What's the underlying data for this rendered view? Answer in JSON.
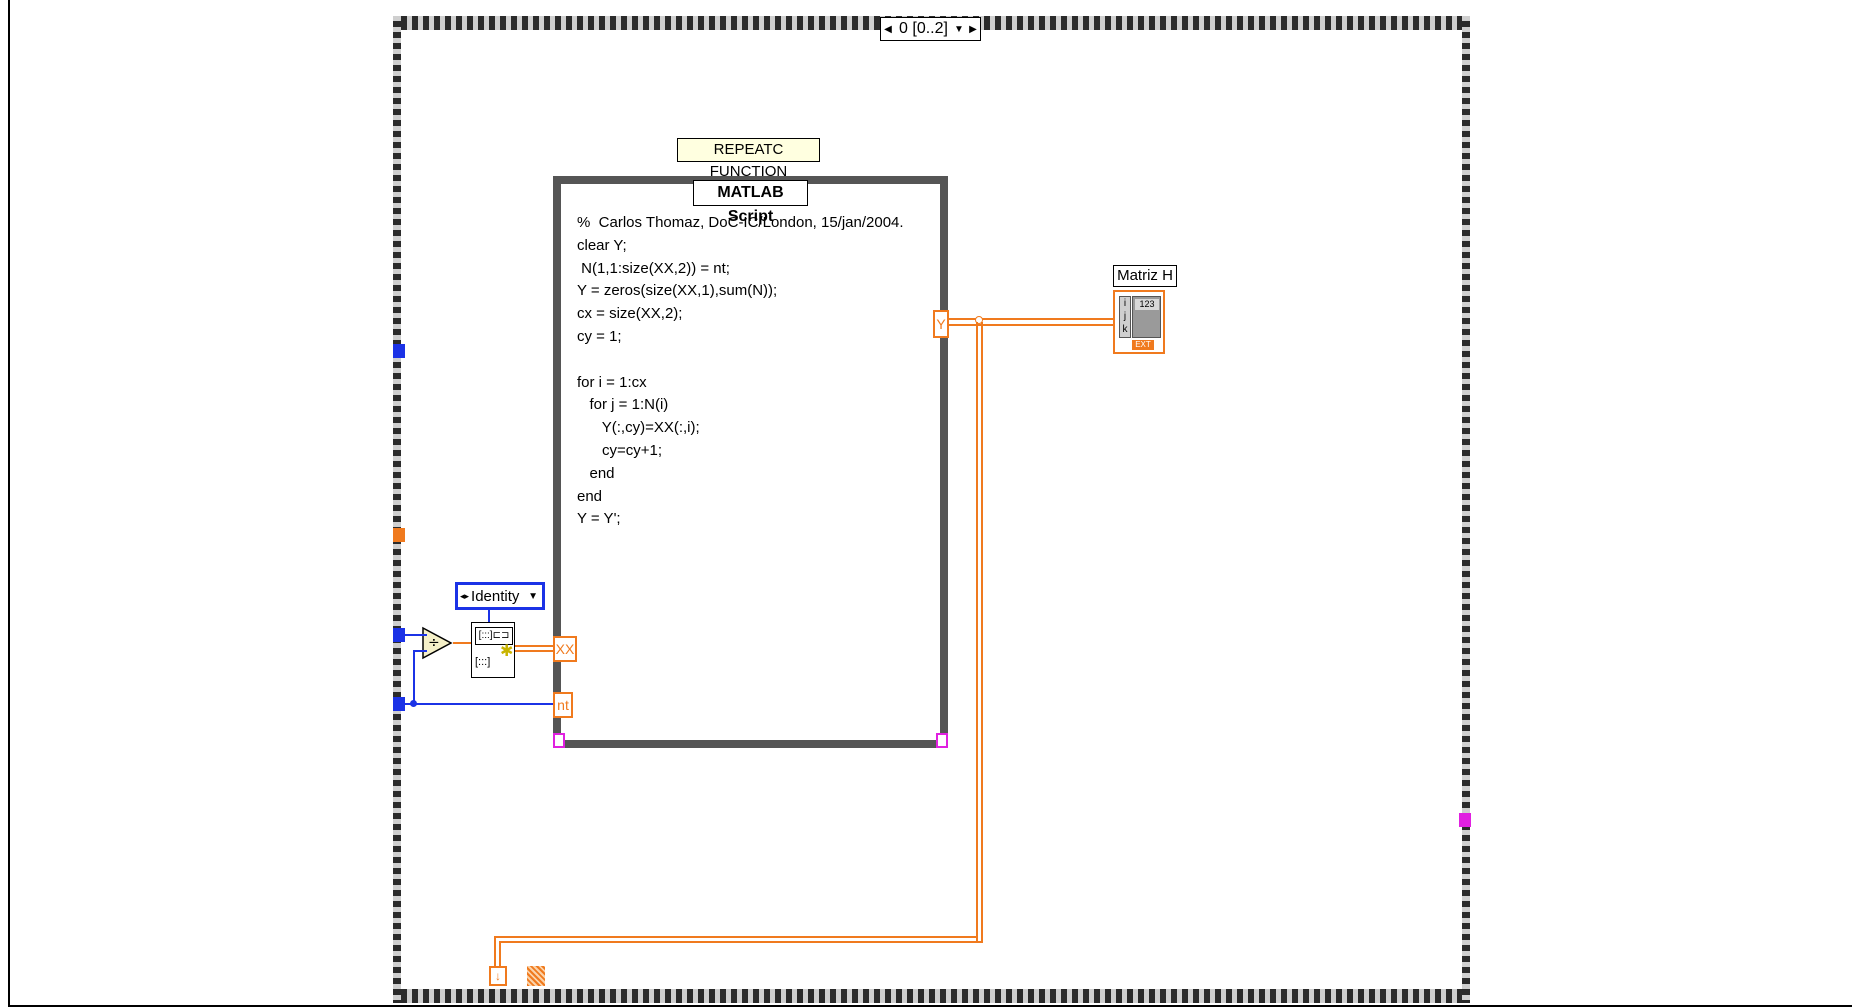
{
  "case_structure": {
    "selector_value": "0 [0..2]",
    "left_arrow": "◀",
    "dropdown_arrow": "▼",
    "right_arrow": "▶"
  },
  "labels": {
    "repeat_function": "REPEATC FUNCTION",
    "matlab_script_title": "MATLAB Script",
    "matriz_h": "Matriz  H",
    "identity": "Identity"
  },
  "script": {
    "code": "%  Carlos Thomaz, DoC-IC/London, 15/jan/2004.\nclear Y;\n N(1,1:size(XX,2)) = nt;\nY = zeros(size(XX,1),sum(N));\ncx = size(XX,2);\ncy = 1;\n\nfor i = 1:cx\n   for j = 1:N(i)\n      Y(:,cy)=XX(:,i);\n      cy=cy+1;\n   end\nend\nY = Y';"
  },
  "terminals": {
    "output_y": "Y",
    "input_xx": "XX",
    "input_nt": "nt"
  },
  "indicator": {
    "index_i": "i",
    "index_j": "j",
    "index_k": "k",
    "value_badge": "123",
    "type_badge": "EXT"
  },
  "colors": {
    "orange_wire": "#f07a1e",
    "blue_wire": "#1b32e6",
    "pink_terminal": "#e020e0",
    "frame_gray": "#555555"
  }
}
